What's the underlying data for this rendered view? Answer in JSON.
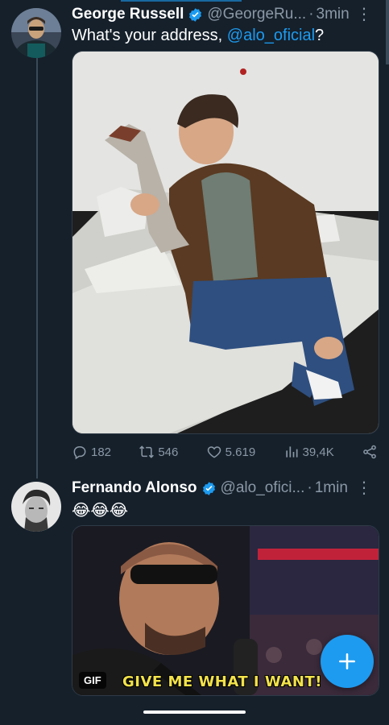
{
  "colors": {
    "background": "#15202b",
    "accent": "#1d9bf0",
    "muted": "#8b98a5",
    "verified": "#1d9bf0",
    "gif_caption": "#f2e24a"
  },
  "tweets": [
    {
      "name": "George Russell",
      "handle": "@GeorgeRu...",
      "time": "3min",
      "text_prefix": "What's your address, ",
      "mention": "@alo_oficial",
      "text_suffix": "?",
      "stats": {
        "replies": "182",
        "retweets": "546",
        "likes": "5.619",
        "views": "39,4K"
      }
    },
    {
      "name": "Fernando Alonso",
      "handle": "@alo_ofici...",
      "time": "1min",
      "text": "😂😂😂",
      "gif_badge": "GIF",
      "gif_caption": "GIVE ME WHAT I WANT!"
    }
  ],
  "icons": [
    "verified-icon",
    "more-icon",
    "reply-icon",
    "retweet-icon",
    "like-icon",
    "views-icon",
    "share-icon",
    "compose-plus-icon"
  ]
}
